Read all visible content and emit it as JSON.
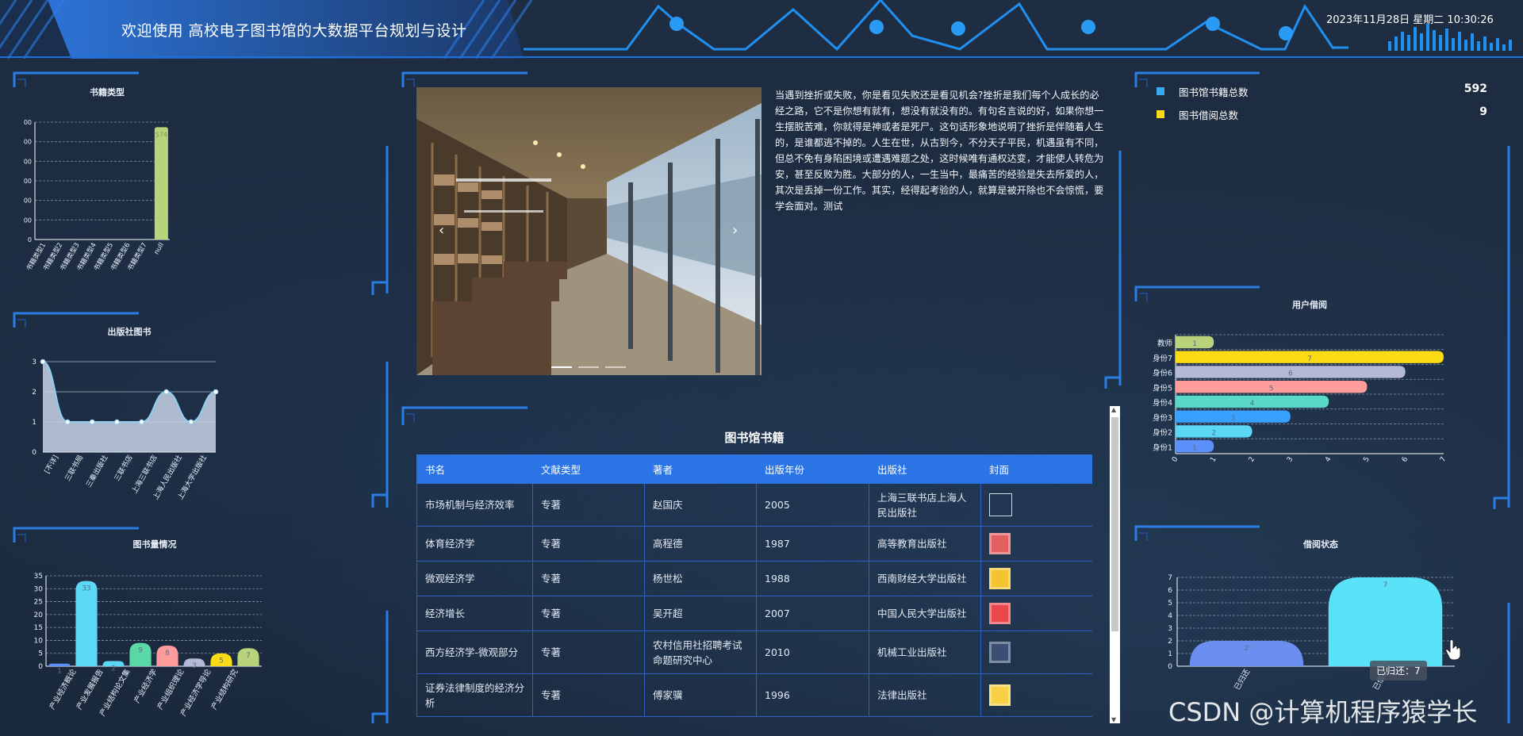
{
  "header": {
    "title": "欢迎使用 高校电子图书馆的大数据平台规划与设计",
    "datetime": "2023年11月28日 星期二 10:30:26"
  },
  "colors": {
    "bg": "#1c2a3e",
    "accent": "#2a74e6",
    "line": "#1f8ff0",
    "table_border": "#2f61c4"
  },
  "panels": {
    "book_type": {
      "title": "书籍类型"
    },
    "publisher": {
      "title": "出版社图书"
    },
    "quantity": {
      "title": "图书量情况"
    },
    "user_borrow": {
      "title": "用户借阅"
    },
    "borrow_status": {
      "title": "借阅状态"
    }
  },
  "chart_data": [
    {
      "id": "book_type",
      "type": "bar",
      "title": "书籍类型",
      "categories": [
        "书籍类型1",
        "书籍类型2",
        "书籍类型3",
        "书籍类型4",
        "书籍类型5",
        "书籍类型6",
        "书籍类型7",
        "null"
      ],
      "values": [
        0,
        0,
        0,
        0,
        0,
        0,
        0,
        574
      ],
      "data_labels": [
        "",
        "",
        "",
        "",
        "",
        "",
        "",
        "574"
      ],
      "ylim": [
        0,
        600
      ],
      "yticks": [
        "00",
        "00",
        "00",
        "00",
        "00",
        "00",
        "0"
      ],
      "grid": true,
      "colors": [
        "#b9d37a"
      ]
    },
    {
      "id": "publisher",
      "type": "area",
      "title": "出版社图书",
      "categories": [
        "[不详]",
        "三联书局",
        "三秦出版社",
        "三联书店",
        "上海三联书店",
        "上海人民出版社",
        "上海大学出版社"
      ],
      "values": [
        3,
        1,
        1,
        1,
        1,
        2,
        1,
        2
      ],
      "ylim": [
        0,
        3
      ],
      "yticks": [
        "0",
        "0.5",
        "1",
        "1.5",
        "2",
        "2.5",
        "3"
      ],
      "grid": true,
      "colors": [
        "#8fd0f2",
        "#c8d2e6"
      ]
    },
    {
      "id": "quantity",
      "type": "bar",
      "title": "图书量情况",
      "categories": [
        "产业经济概论",
        "产业发展报告",
        "产业结构论文集",
        "产业经济学",
        "产业组织理论",
        "产业经济学导论",
        "产业结构研究"
      ],
      "values": [
        1,
        33,
        2,
        9,
        8,
        3,
        5,
        7
      ],
      "ylim": [
        0,
        35
      ],
      "yticks": [
        "0",
        "5",
        "10",
        "15",
        "20",
        "25",
        "30",
        "35"
      ],
      "grid": true,
      "colors": [
        "#5b8ff9",
        "#5ad8f5",
        "#5ad8f5",
        "#5ad8a6",
        "#ff9d9d",
        "#b5b9d8",
        "#fadb14",
        "#b9d37a"
      ]
    },
    {
      "id": "user_borrow",
      "type": "bar",
      "orientation": "horizontal",
      "title": "用户借阅",
      "categories": [
        "身份1",
        "身份2",
        "身份3",
        "身份4",
        "身份5",
        "身份6",
        "身份7",
        "教师"
      ],
      "values": [
        1,
        2,
        3,
        4,
        5,
        6,
        7,
        1
      ],
      "xlim": [
        0,
        7
      ],
      "xticks": [
        "0",
        "1",
        "2",
        "3",
        "4",
        "5",
        "6",
        "7"
      ],
      "grid": true,
      "colors": [
        "#5b8ff9",
        "#5ad8f5",
        "#3aa0ff",
        "#5ad8c6",
        "#ff9d9d",
        "#b5b9d8",
        "#fadb14",
        "#b9d37a"
      ]
    },
    {
      "id": "borrow_status",
      "type": "bar",
      "title": "借阅状态",
      "categories": [
        "已归还",
        "已借阅"
      ],
      "values": [
        2,
        7
      ],
      "ylim": [
        0,
        7
      ],
      "yticks": [
        "0",
        "1",
        "2",
        "3",
        "4",
        "5",
        "6",
        "7"
      ],
      "grid": true,
      "colors": [
        "#6a8ff0",
        "#5ae2f8"
      ],
      "tooltip": "已归还：7"
    }
  ],
  "stats": [
    {
      "label": "图书馆书籍总数",
      "value": "592",
      "color": "#3aa7f5"
    },
    {
      "label": "图书借阅总数",
      "value": "9",
      "color": "#fadb14"
    }
  ],
  "quote": "当遇到挫折或失败，你是看见失败还是看见机会?挫折是我们每个人成长的必经之路，它不是你想有就有，想没有就没有的。有句名言说的好，如果你想一生摆脱苦难，你就得是神或者是死尸。这句话形象地说明了挫折是伴随着人生的，是谁都逃不掉的。人生在世，从古到今，不分天子平民，机遇虽有不同，但总不免有身陷困境或遭遇难题之处，这时候唯有通权达变，才能使人转危为安，甚至反败为胜。大部分的人，一生当中，最痛苦的经验是失去所爱的人，其次是丢掉一份工作。其实，经得起考验的人，就算是被开除也不会惊慌，要学会面对。测试",
  "carousel": {
    "indicators": 3,
    "active": 0
  },
  "table": {
    "title": "图书馆书籍",
    "columns": [
      "书名",
      "文献类型",
      "著者",
      "出版年份",
      "出版社",
      "封面"
    ],
    "rows": [
      {
        "name": "市场机制与经济效率",
        "type": "专著",
        "author": "赵国庆",
        "year": "2005",
        "publisher": "上海三联书店上海人民出版社",
        "cover": "broken"
      },
      {
        "name": "体育经济学",
        "type": "专著",
        "author": "高程德",
        "year": "1987",
        "publisher": "高等教育出版社",
        "cover": "#e06060"
      },
      {
        "name": "微观经济学",
        "type": "专著",
        "author": "杨世松",
        "year": "1988",
        "publisher": "西南财经大学出版社",
        "cover": "#f4c430"
      },
      {
        "name": "经济增长",
        "type": "专著",
        "author": "吴开超",
        "year": "2007",
        "publisher": "中国人民大学出版社",
        "cover": "#e8474c"
      },
      {
        "name": "西方经济学-微观部分",
        "type": "专著",
        "author": "农村信用社招聘考试命题研究中心",
        "year": "2010",
        "publisher": "机械工业出版社",
        "cover": "#3a4f73"
      },
      {
        "name": "证券法律制度的经济分析",
        "type": "专著",
        "author": "傅家骥",
        "year": "1996",
        "publisher": "法律出版社",
        "cover": "#f7d048"
      }
    ]
  },
  "watermark": "CSDN @计算机程序猿学长"
}
